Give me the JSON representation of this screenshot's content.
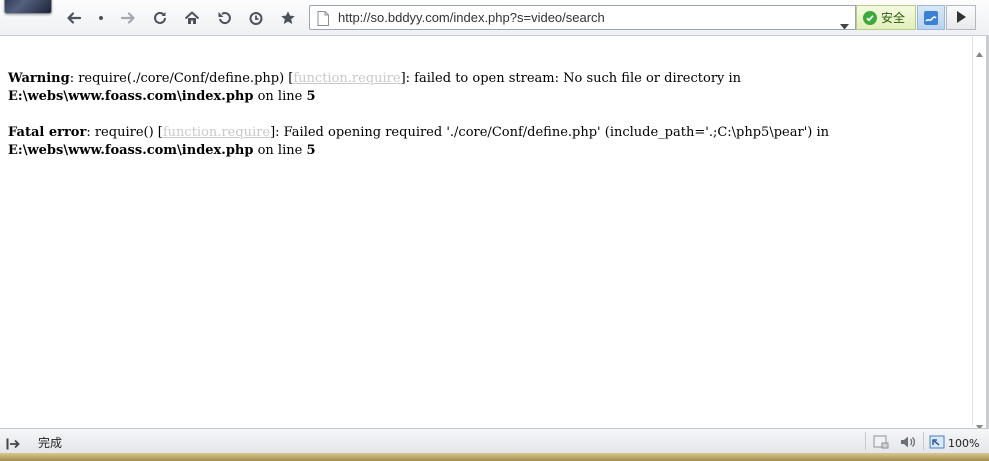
{
  "toolbar": {
    "buttons": [
      "back-icon",
      "dot-icon",
      "forward-icon",
      "refresh-icon",
      "home-icon",
      "undo-icon",
      "history-icon",
      "star-icon"
    ],
    "address": "http://so.bddyy.com/index.php?s=video/search",
    "safe_label": "安全"
  },
  "content": {
    "warning": {
      "label": "Warning",
      "text1": ": require(./core/Conf/define.php) [",
      "link": "function.require",
      "text2": "]: failed to open stream: No such file or directory in ",
      "path": "E:\\webs\\www.foass.com\\index.php",
      "text3": " on line ",
      "line": "5"
    },
    "fatal": {
      "label": "Fatal error",
      "text1": ": require() [",
      "link": "function.require",
      "text2": "]: Failed opening required './core/Conf/define.php' (include_path='.;C:\\php5\\pear') in ",
      "path": "E:\\webs\\www.foass.com\\index.php",
      "text3": " on line ",
      "line": "5"
    }
  },
  "statusbar": {
    "status": "完成",
    "zoom": "100%"
  },
  "colors": {
    "link": "#c9c9c9",
    "safe_green": "#3ca93a"
  }
}
